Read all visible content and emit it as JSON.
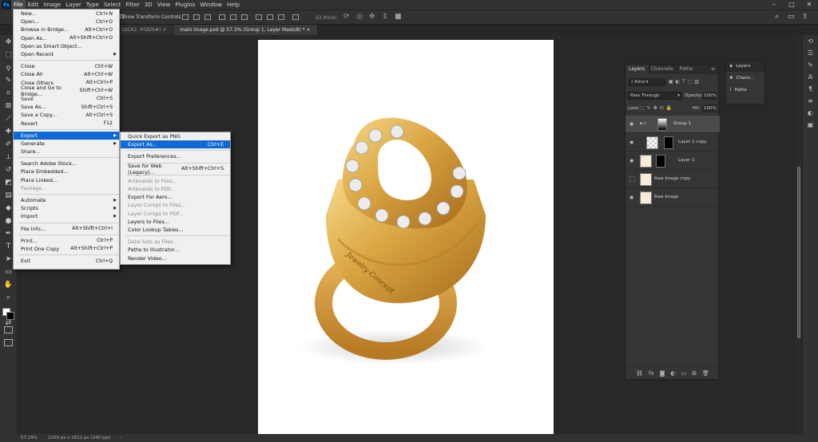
{
  "menubar": {
    "items": [
      "File",
      "Edit",
      "Image",
      "Layer",
      "Type",
      "Select",
      "Filter",
      "3D",
      "View",
      "Plugins",
      "Window",
      "Help"
    ]
  },
  "options": {
    "show_transform": "Show Transform Controls",
    "mode_3d": "3D Mode:"
  },
  "tabs": [
    {
      "label": "LUCK2, RGB/8#) ×"
    },
    {
      "label": "main image.psd @ 57.3% (Group 1, Layer Mask/8) * ×"
    }
  ],
  "file_menu": {
    "items": [
      {
        "label": "New...",
        "shortcut": "Ctrl+N"
      },
      {
        "label": "Open...",
        "shortcut": "Ctrl+O"
      },
      {
        "label": "Browse in Bridge...",
        "shortcut": "Alt+Ctrl+O"
      },
      {
        "label": "Open As...",
        "shortcut": "Alt+Shift+Ctrl+O"
      },
      {
        "label": "Open as Smart Object...",
        "shortcut": ""
      },
      {
        "label": "Open Recent",
        "shortcut": ""
      },
      {
        "label": "Close",
        "shortcut": "Ctrl+W"
      },
      {
        "label": "Close All",
        "shortcut": "Alt+Ctrl+W"
      },
      {
        "label": "Close Others",
        "shortcut": "Alt+Ctrl+P"
      },
      {
        "label": "Close and Go to Bridge...",
        "shortcut": "Shift+Ctrl+W"
      },
      {
        "label": "Save",
        "shortcut": "Ctrl+S"
      },
      {
        "label": "Save As...",
        "shortcut": "Shift+Ctrl+S"
      },
      {
        "label": "Save a Copy...",
        "shortcut": "Alt+Ctrl+S"
      },
      {
        "label": "Revert",
        "shortcut": "F12"
      },
      {
        "label": "Export",
        "shortcut": ""
      },
      {
        "label": "Generate",
        "shortcut": ""
      },
      {
        "label": "Share...",
        "shortcut": ""
      },
      {
        "label": "Search Adobe Stock...",
        "shortcut": ""
      },
      {
        "label": "Place Embedded...",
        "shortcut": ""
      },
      {
        "label": "Place Linked...",
        "shortcut": ""
      },
      {
        "label": "Package...",
        "shortcut": ""
      },
      {
        "label": "Automate",
        "shortcut": ""
      },
      {
        "label": "Scripts",
        "shortcut": ""
      },
      {
        "label": "Import",
        "shortcut": ""
      },
      {
        "label": "File Info...",
        "shortcut": "Alt+Shift+Ctrl+I"
      },
      {
        "label": "Print...",
        "shortcut": "Ctrl+P"
      },
      {
        "label": "Print One Copy",
        "shortcut": "Alt+Shift+Ctrl+P"
      },
      {
        "label": "Exit",
        "shortcut": "Ctrl+Q"
      }
    ]
  },
  "export_menu": {
    "items": [
      {
        "label": "Quick Export as PNG",
        "shortcut": ""
      },
      {
        "label": "Export As...",
        "shortcut": "Ctrl+E"
      },
      {
        "label": "Export Preferences...",
        "shortcut": ""
      },
      {
        "label": "Save for Web (Legacy)...",
        "shortcut": "Alt+Shift+Ctrl+S"
      },
      {
        "label": "Artboards to Files...",
        "shortcut": ""
      },
      {
        "label": "Artboards to PDF...",
        "shortcut": ""
      },
      {
        "label": "Export For Aero...",
        "shortcut": ""
      },
      {
        "label": "Layer Comps to Files...",
        "shortcut": ""
      },
      {
        "label": "Layer Comps to PDF...",
        "shortcut": ""
      },
      {
        "label": "Layers to Files...",
        "shortcut": ""
      },
      {
        "label": "Color Lookup Tables...",
        "shortcut": ""
      },
      {
        "label": "Data Sets as Files...",
        "shortcut": ""
      },
      {
        "label": "Paths to Illustrator...",
        "shortcut": ""
      },
      {
        "label": "Render Video...",
        "shortcut": ""
      }
    ]
  },
  "layers_panel": {
    "tabs": [
      "Layers",
      "Channels",
      "Paths"
    ],
    "kind": "Kind",
    "blend_mode": "Pass Through",
    "opacity_label": "Opacity:",
    "opacity_value": "100%",
    "lock_label": "Lock:",
    "fill_label": "Fill:",
    "fill_value": "100%",
    "layers": [
      {
        "name": "Group 1"
      },
      {
        "name": "Layer 1 copy"
      },
      {
        "name": "Layer 1"
      },
      {
        "name": "Raw Image copy"
      },
      {
        "name": "Raw Image"
      }
    ]
  },
  "mini_panel": {
    "items": [
      "Layers",
      "Chann...",
      "Paths"
    ]
  },
  "status": {
    "zoom": "57.29%",
    "doc_info": "1209 px x 1611 px (240 ppi)"
  },
  "ring_engraving": "Jewelry Concept",
  "colors": {
    "menu_highlight": "#0f6ad6",
    "ui_dark": "#323232",
    "canvas_bg": "#282828",
    "gold": "#d9a441"
  }
}
